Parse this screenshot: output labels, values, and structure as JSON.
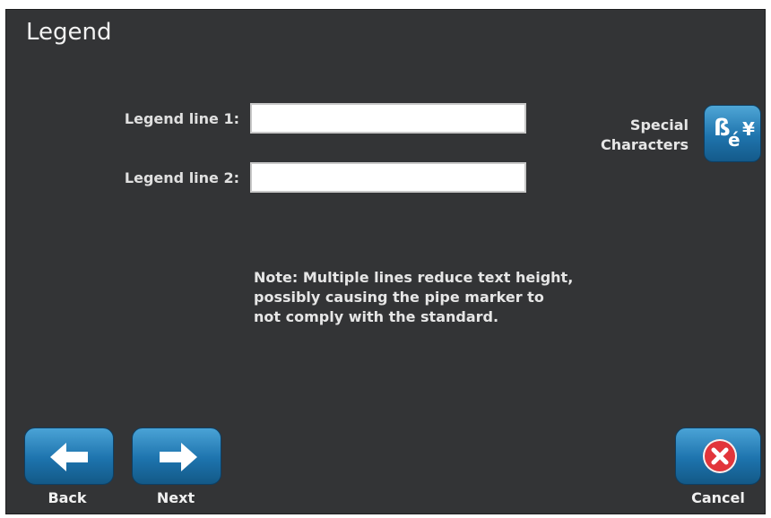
{
  "page": {
    "title": "Legend"
  },
  "form": {
    "line1": {
      "label": "Legend line 1:",
      "value": ""
    },
    "line2": {
      "label": "Legend line 2:",
      "value": ""
    }
  },
  "special_characters": {
    "label_line1": "Special",
    "label_line2": "Characters",
    "icon_glyph_1": "ß",
    "icon_glyph_2": "é",
    "icon_glyph_3": "¥"
  },
  "note": {
    "line1": "Note: Multiple lines reduce text height,",
    "line2": "possibly causing the pipe marker to",
    "line3": "not comply with the standard."
  },
  "nav": {
    "back_label": "Back",
    "next_label": "Next",
    "cancel_label": "Cancel"
  },
  "colors": {
    "background": "#333436",
    "button_blue": "#1f74ad",
    "cancel_red": "#e2353b"
  }
}
